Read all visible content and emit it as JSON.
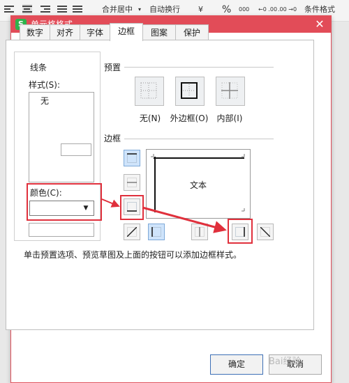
{
  "ribbon": {
    "merge_center": "合并居中",
    "wrap_text": "自动换行",
    "currency_symbol": "¥",
    "percent_symbol": "%",
    "thousands": "000",
    "decimals_more": "←0 .00",
    "decimals_less": ".00 →0",
    "conditional_format": "条件格式"
  },
  "dialog": {
    "title": "单元格格式",
    "close_glyph": "✕",
    "app_icon_letter": "S",
    "tabs": [
      {
        "label": "数字"
      },
      {
        "label": "对齐"
      },
      {
        "label": "字体"
      },
      {
        "label": "边框"
      },
      {
        "label": "图案"
      },
      {
        "label": "保护"
      }
    ],
    "active_tab": "边框",
    "line_group": {
      "label": "线条",
      "style_label": "样式(S):",
      "style_none": "无",
      "color_label": "颜色(C):",
      "color_value": ""
    },
    "preset": {
      "label": "预置",
      "items": [
        {
          "label": "无(N)"
        },
        {
          "label": "外边框(O)"
        },
        {
          "label": "内部(I)"
        }
      ]
    },
    "border": {
      "label": "边框",
      "preview_text": "文本"
    },
    "hint": "单击预置选项、预览草图及上面的按钮可以添加边框样式。",
    "ok_label": "确定",
    "cancel_label": "取消"
  },
  "watermark": "Bai经验",
  "colors": {
    "title_bar": "#e24c58",
    "annotation": "#e0303c"
  }
}
